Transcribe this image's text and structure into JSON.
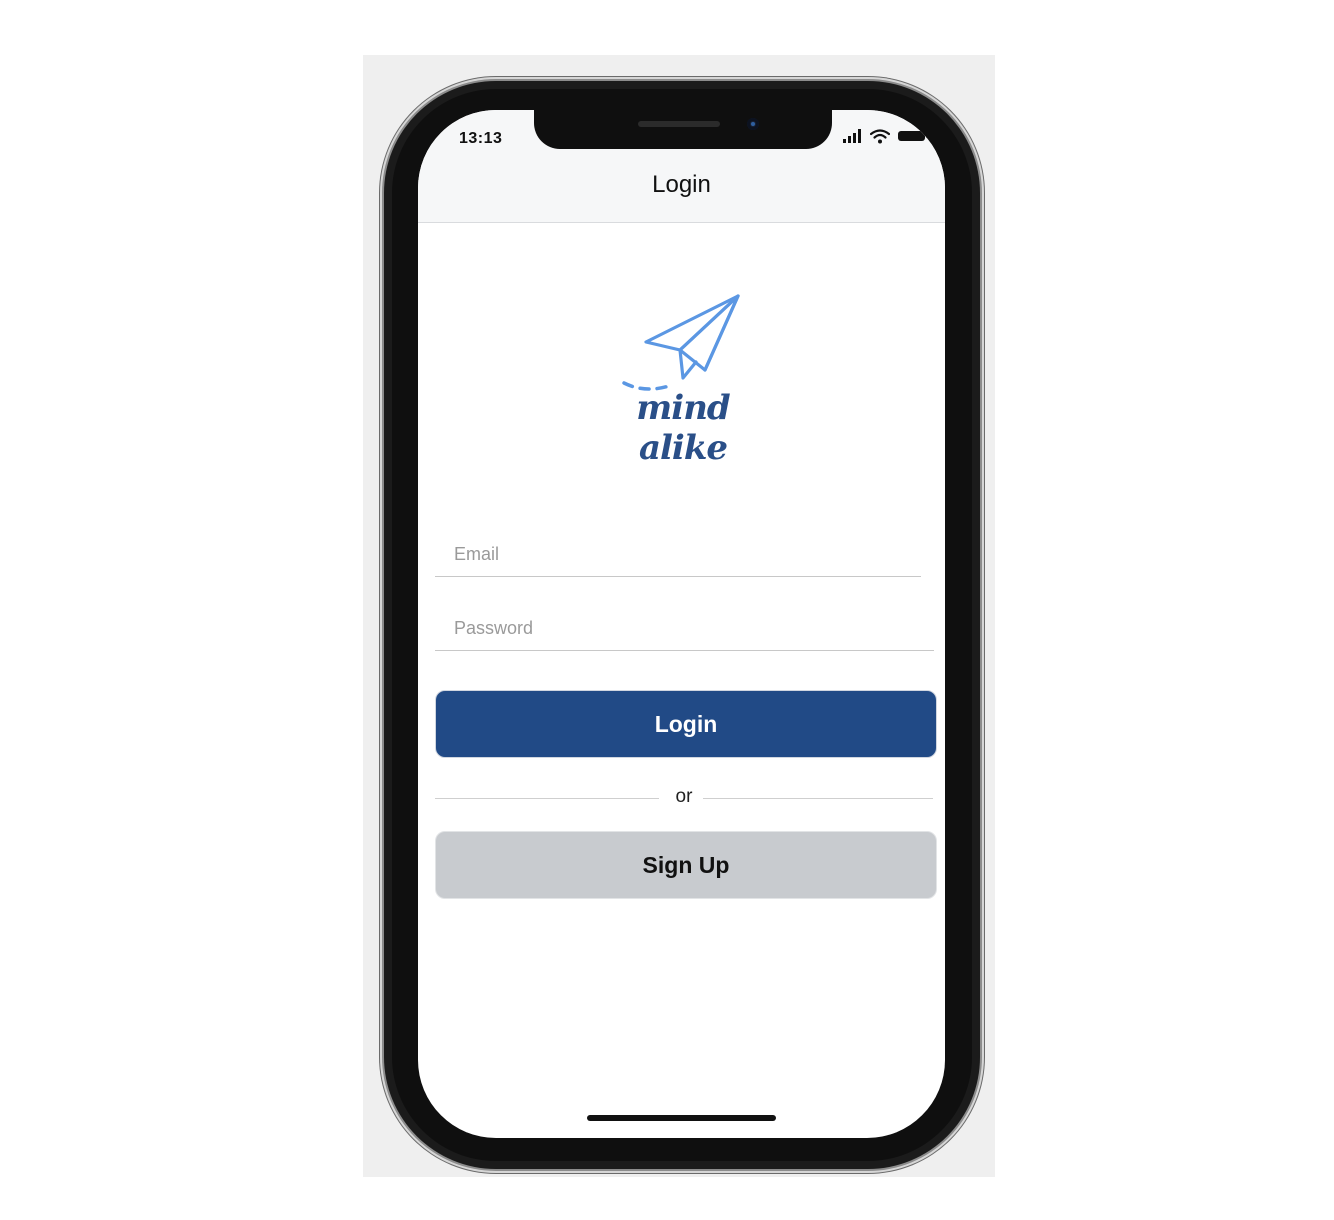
{
  "status_bar": {
    "time": "13:13"
  },
  "header": {
    "title": "Login"
  },
  "logo": {
    "text": "mind alike",
    "colors": {
      "plane": "#5b97e3",
      "text": "#2a4f88"
    }
  },
  "form": {
    "email_placeholder": "Email",
    "password_placeholder": "Password"
  },
  "buttons": {
    "login_label": "Login",
    "signup_label": "Sign Up"
  },
  "divider": {
    "label": "or"
  },
  "colors": {
    "primary": "#214a86",
    "secondary": "#c8cbcf"
  },
  "icons": [
    "signal-icon",
    "wifi-icon",
    "battery-icon",
    "paper-plane-icon"
  ]
}
